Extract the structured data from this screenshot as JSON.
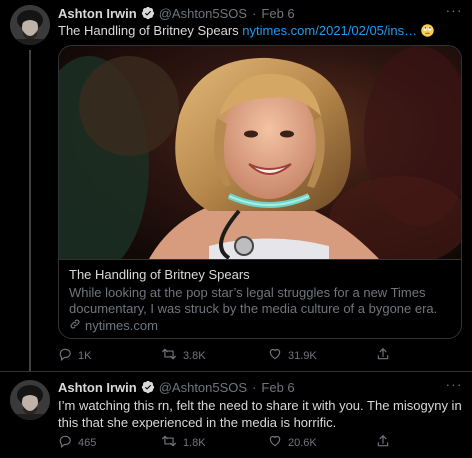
{
  "tweets": [
    {
      "author_name": "Ashton Irwin",
      "handle": "@Ashton5SOS",
      "separator": "·",
      "date": "Feb 6",
      "text": "The Handling of Britney Spears ",
      "link_text": "nytimes.com/2021/02/05/ins…",
      "emoji": "rolling-eyes-emoji",
      "card": {
        "title": "The Handling of Britney Spears",
        "description": "While looking at the pop star’s legal struggles for a new Times documentary, I was struck by the media culture of a bygone era.",
        "domain": "nytimes.com"
      },
      "stats": {
        "replies": "1K",
        "retweets": "3.8K",
        "likes": "31.9K"
      }
    },
    {
      "author_name": "Ashton Irwin",
      "handle": "@Ashton5SOS",
      "separator": "·",
      "date": "Feb 6",
      "text": "I’m watching this rn, felt the need to share it with you. The misogyny in this that she experienced in the media is horrific.",
      "stats": {
        "replies": "465",
        "retweets": "1.8K",
        "likes": "20.6K"
      }
    }
  ],
  "colors": {
    "background": "#000000",
    "text_primary": "#d9d9d9",
    "text_secondary": "#6e767d",
    "link": "#1d9bf0",
    "verified_badge": "#d9d9d9",
    "border": "#2f3336",
    "thread_line": "#3d4247"
  },
  "icons": {
    "verified": "verified-badge-icon",
    "more": "more-options-icon",
    "reply": "reply-icon",
    "retweet": "retweet-icon",
    "like": "heart-icon",
    "share": "share-icon",
    "link": "link-icon"
  }
}
